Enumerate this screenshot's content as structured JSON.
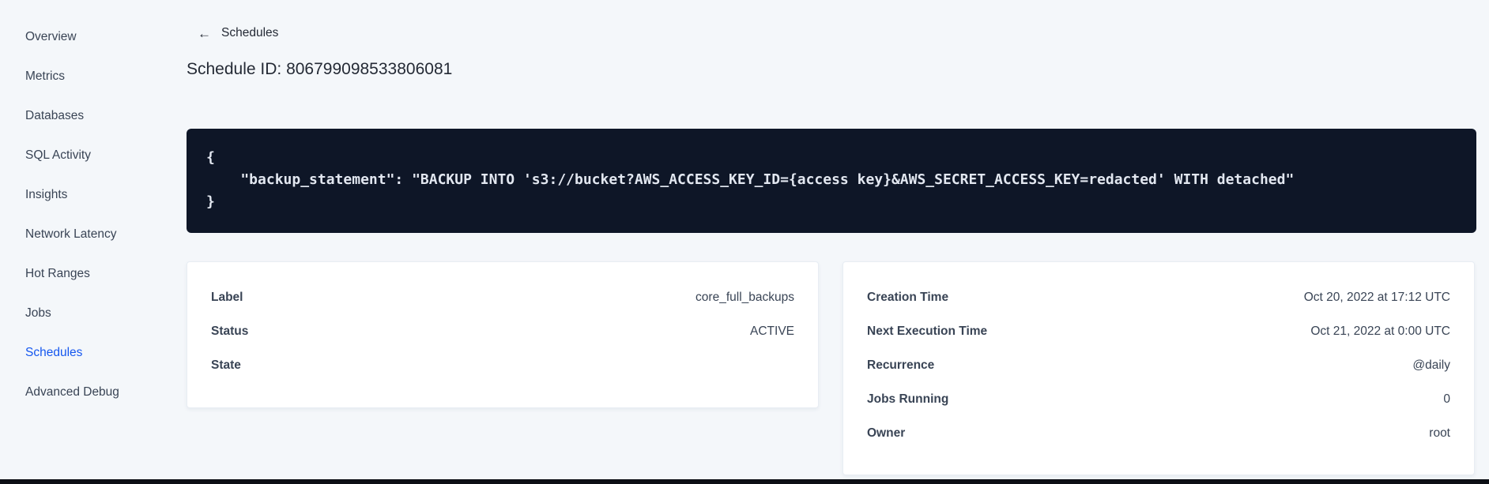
{
  "sidebar": {
    "items": [
      {
        "label": "Overview",
        "active": false
      },
      {
        "label": "Metrics",
        "active": false
      },
      {
        "label": "Databases",
        "active": false
      },
      {
        "label": "SQL Activity",
        "active": false
      },
      {
        "label": "Insights",
        "active": false
      },
      {
        "label": "Network Latency",
        "active": false
      },
      {
        "label": "Hot Ranges",
        "active": false
      },
      {
        "label": "Jobs",
        "active": false
      },
      {
        "label": "Schedules",
        "active": true
      },
      {
        "label": "Advanced Debug",
        "active": false
      }
    ]
  },
  "header": {
    "back_label": "Schedules",
    "back_icon": "←",
    "title": "Schedule ID: 806799098533806081"
  },
  "code_block": {
    "lines": [
      "{",
      "    \"backup_statement\": \"BACKUP INTO 's3://bucket?AWS_ACCESS_KEY_ID={access key}&AWS_SECRET_ACCESS_KEY=redacted' WITH detached\"",
      "}"
    ]
  },
  "details_card": {
    "rows": [
      {
        "label": "Label",
        "value": "core_full_backups"
      },
      {
        "label": "Status",
        "value": "ACTIVE"
      },
      {
        "label": "State",
        "value": ""
      }
    ]
  },
  "schedule_card": {
    "rows": [
      {
        "label": "Creation Time",
        "value": "Oct 20, 2022 at 17:12 UTC"
      },
      {
        "label": "Next Execution Time",
        "value": "Oct 21, 2022 at 0:00 UTC"
      },
      {
        "label": "Recurrence",
        "value": "@daily"
      },
      {
        "label": "Jobs Running",
        "value": "0"
      },
      {
        "label": "Owner",
        "value": "root"
      }
    ]
  },
  "colors": {
    "accent_blue": "#1557ef",
    "page_background": "#f4f7fa",
    "code_background": "#0e1627",
    "text_primary": "#242a35",
    "text_secondary": "#394455"
  }
}
